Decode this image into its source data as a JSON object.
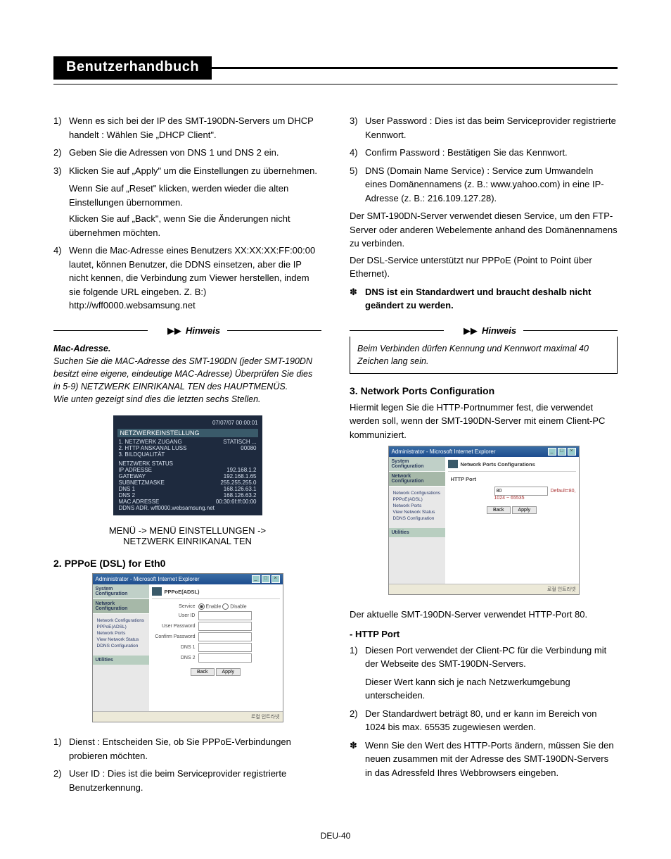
{
  "header_title": "Benutzerhandbuch",
  "footer": "DEU-40",
  "left": {
    "item1": "Wenn es sich bei der IP des SMT-190DN-Servers um DHCP handelt : Wählen Sie „DHCP Client\".",
    "item2": "Geben Sie die Adressen von DNS 1 und DNS 2 ein.",
    "item3_a": "Klicken Sie auf „Apply\" um die Einstellungen zu übernehmen.",
    "item3_b": "Wenn Sie auf „Reset\" klicken, werden wieder die alten Einstellungen übernommen.",
    "item3_c": "Klicken Sie auf „Back\", wenn Sie die Änderungen nicht übernehmen möchten.",
    "item4": "Wenn die Mac-Adresse eines Benutzers XX:XX:XX:FF:00:00 lautet, können Benutzer, die DDNS einsetzen, aber die IP nicht kennen, die Verbindung zum Viewer herstellen, indem sie folgende URL eingeben. Z. B:) http://wff0000.websamsung.net",
    "hinweis_label": "Hinweis",
    "hinweis_title": "Mac-Adresse.",
    "hinweis_body1": "Suchen Sie die MAC-Adresse des SMT-190DN (jeder SMT-190DN besitzt eine eigene, eindeutige MAC-Adresse) Überprüfen Sie dies in 5-9) NETZWERK EINRIKANAL TEN des HAUPTMENÜS.",
    "hinweis_body2": "Wie unten gezeigt sind dies die letzten sechs Stellen.",
    "osd": {
      "time": "07/07/07  00:00:01",
      "title": "NETZWERKEINSTELLUNG",
      "l1a": "1. NETZWERK ZUGANG",
      "l1b": "STATISCH ...",
      "l2a": "2. HTTP ANSKANAL LUSS",
      "l2b": "00080",
      "l3a": "3. BILDQUALITÄT",
      "l3b": "",
      "status": "NETZWERK STATUS",
      "r1a": "IP ADRESSE",
      "r1b": "192.168.1.2",
      "r2a": "GATEWAY",
      "r2b": "192.168.1.65",
      "r3a": "SUBNETZMASKE",
      "r3b": "255.255.255.0",
      "r4a": "DNS 1",
      "r4b": "168.126.63.1",
      "r5a": "DNS 2",
      "r5b": "168.126.63.2",
      "r6a": "MAC ADRESSE",
      "r6b": "00:30:6f:ff:00:00",
      "r7": "DDNS ADR. wff0000.websamsung.net"
    },
    "caption1": "MENÜ -> MENÜ EINSTELLUNGEN ->",
    "caption2": "NETZWERK EINRIKANAL TEN",
    "sec2_title": "2. PPPoE (DSL) for Eth0",
    "browser1": {
      "titlebar": "Administrator - Microsoft Internet Explorer",
      "tab1": "System Configuration",
      "tab2": "Network Configuration",
      "link1": "Network Configurations",
      "link2": "PPPoE(ADSL)",
      "link3": "Network Ports",
      "link4": "View Network Status",
      "link5": "DDNS Configuration",
      "util": "Utilities",
      "hdr": "PPPoE(ADSL)",
      "f_service": "Service",
      "f_enable": "Enable",
      "f_disable": "Disable",
      "f_userid": "User ID",
      "f_userpw": "User Password",
      "f_confirm": "Confirm Password",
      "f_dns1": "DNS 1",
      "f_dns2": "DNS 2",
      "btn_back": "Back",
      "btn_apply": "Apply",
      "status_right": "로컬 인트라넷"
    },
    "item_b1": "Dienst : Entscheiden Sie, ob Sie PPPoE-Verbindungen probieren möchten.",
    "item_b2": "User ID : Dies ist die beim Serviceprovider registrierte Benutzerkennung."
  },
  "right": {
    "item3": "User Password : Dies ist das beim Serviceprovider registrierte Kennwort.",
    "item4": "Confirm Password : Bestätigen Sie das Kennwort.",
    "item5": "DNS (Domain Name Service) : Service zum Umwandeln eines Domänennamens (z. B.: www.yahoo.com) in eine IP-Adresse (z. B.: 216.109.127.28).",
    "para1": "Der SMT-190DN-Server verwendet diesen Service, um den FTP-Server oder anderen Webelemente anhand des Domänennamens zu verbinden.",
    "para2": "Der DSL-Service unterstützt nur PPPoE (Point to Point über Ethernet).",
    "star1": "DNS ist ein Standardwert und braucht deshalb nicht geändert zu werden.",
    "hinweis_label": "Hinweis",
    "hinweis_body": "Beim Verbinden dürfen Kennung und Kennwort maximal 40 Zeichen lang sein.",
    "sec3_title": "3.  Network Ports Configuration",
    "sec3_intro": "Hiermit legen Sie die HTTP-Portnummer fest, die verwendet werden soll, wenn der SMT-190DN-Server mit einem Client-PC kommuniziert.",
    "browser2": {
      "titlebar": "Administrator - Microsoft Internet Explorer",
      "tab1": "System Configuration",
      "tab2": "Network Configuration",
      "link1": "Network Configurations",
      "link2": "PPPoE(ADSL)",
      "link3": "Network Ports",
      "link4": "View Network Status",
      "link5": "DDNS Configuration",
      "util": "Utilities",
      "hdr": "Network Ports Configurations",
      "f_http": "HTTP Port",
      "f_http_val": "80",
      "f_http_hint": "Default=80, 1024 ~ 65535",
      "btn_back": "Back",
      "btn_apply": "Apply",
      "status_right": "로컬 인트라넷"
    },
    "para3": "Der aktuelle SMT-190DN-Server verwendet HTTP-Port 80.",
    "sub_http": "-  HTTP Port",
    "hp1a": "Diesen Port verwendet der Client-PC für die Verbindung mit der Webseite des SMT-190DN-Servers.",
    "hp1b": "Dieser Wert kann sich je nach Netzwerkumgebung unterscheiden.",
    "hp2": "Der Standardwert beträgt 80, und er kann im Bereich von 1024 bis max. 65535 zugewiesen werden.",
    "star2": "Wenn Sie den Wert des HTTP-Ports ändern, müssen Sie den neuen zusammen mit der Adresse des SMT-190DN-Servers in das Adressfeld Ihres Webbrowsers eingeben."
  }
}
